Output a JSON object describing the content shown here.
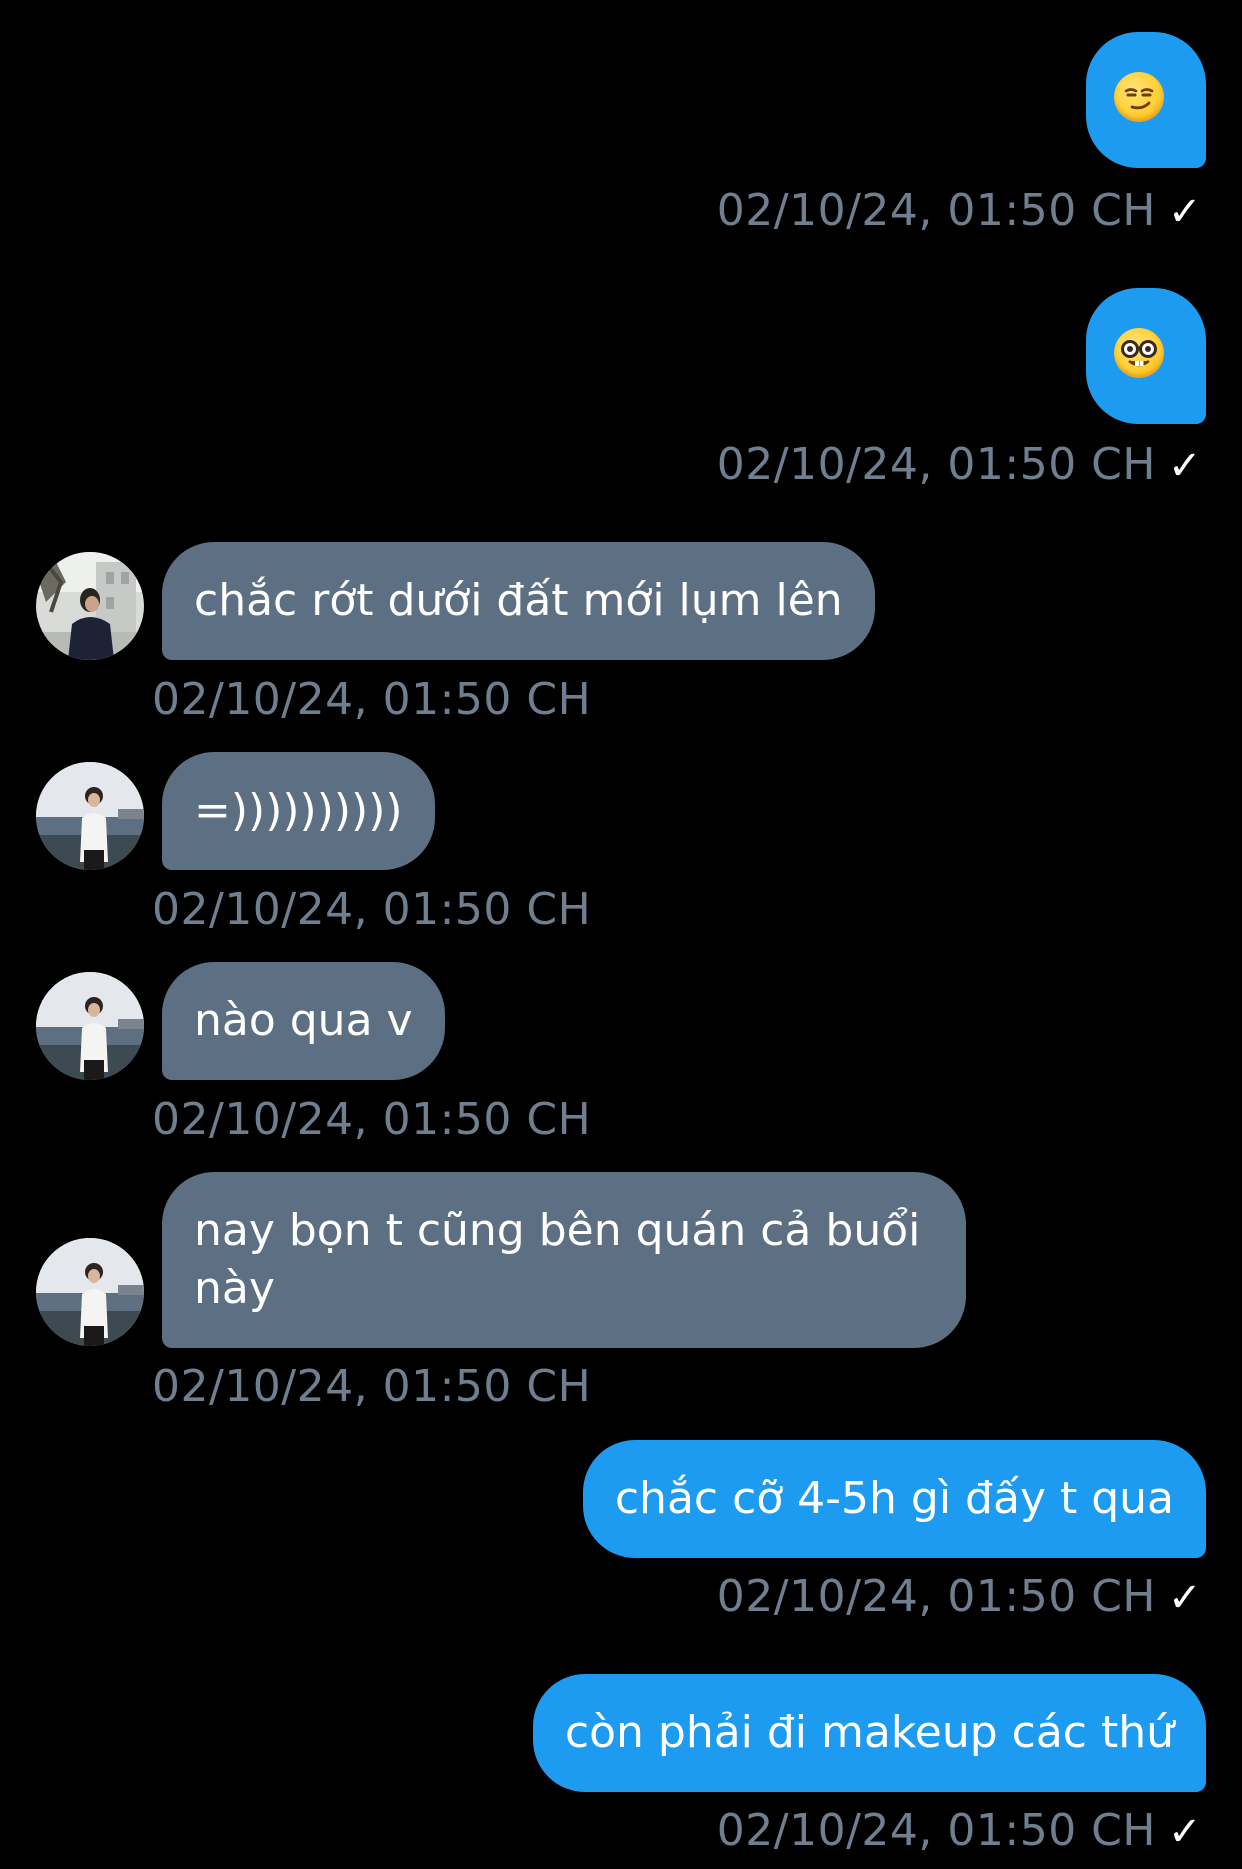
{
  "colors": {
    "background": "#000000",
    "sent_bubble": "#1d9bf0",
    "received_bubble": "#5d6f82",
    "timestamp": "#6f7f90"
  },
  "messages": [
    {
      "direction": "sent",
      "emoji": "smirking-face",
      "timestamp": "02/10/24, 01:50 CH",
      "status": "✓"
    },
    {
      "direction": "sent",
      "emoji": "nerd-face",
      "timestamp": "02/10/24, 01:50 CH",
      "status": "✓"
    },
    {
      "direction": "received",
      "avatar": "avatar-street",
      "text": "chắc rớt dưới đất mới lụm lên",
      "timestamp": "02/10/24, 01:50 CH"
    },
    {
      "direction": "received",
      "avatar": "avatar-sea",
      "text": "=))))))))))",
      "timestamp": "02/10/24, 01:50 CH"
    },
    {
      "direction": "received",
      "avatar": "avatar-sea",
      "text": "nào qua v",
      "timestamp": "02/10/24, 01:50 CH"
    },
    {
      "direction": "received",
      "avatar": "avatar-sea",
      "text": "nay bọn t cũng bên quán cả buổi này",
      "timestamp": "02/10/24, 01:50 CH"
    },
    {
      "direction": "sent",
      "text": "chắc cỡ 4-5h gì đấy t qua",
      "timestamp": "02/10/24, 01:50 CH",
      "status": "✓"
    },
    {
      "direction": "sent",
      "text": "còn phải đi makeup các thứ",
      "timestamp": "02/10/24, 01:50 CH",
      "status": "✓"
    }
  ]
}
